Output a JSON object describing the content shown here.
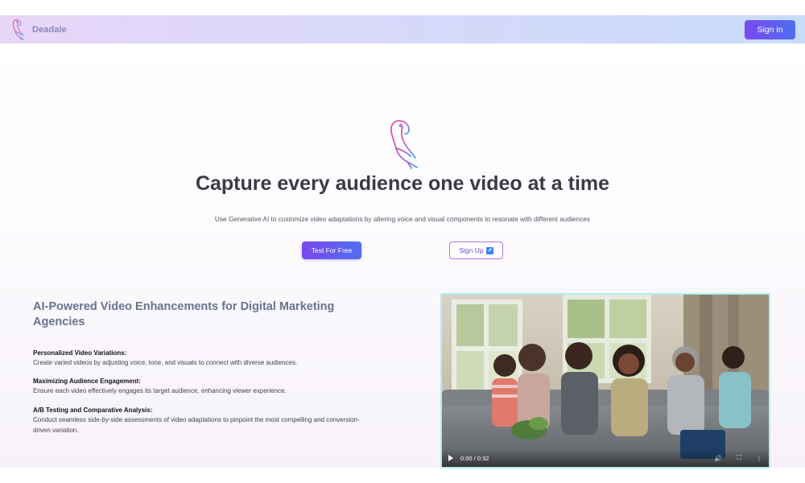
{
  "nav": {
    "brand": "Deadale",
    "signin_label": "Sign in"
  },
  "hero": {
    "title": "Capture every audience one video at a time",
    "subtitle": "Use Generative AI to customize video adaptations by altering voice and visual components to resonate with different audiences",
    "test_button": "Test For Free",
    "signup_button": "Sign Up",
    "signup_icon": "north-east-arrow-icon"
  },
  "features": {
    "heading": "AI-Powered Video Enhancements for Digital Marketing Agencies",
    "items": [
      {
        "title": "Personalized Video Variations:",
        "desc": "Create varied videos by adjusting voice, tone, and visuals to connect with diverse audiences."
      },
      {
        "title": "Maximizing Audience Engagement:",
        "desc": "Ensure each video effectively engages its target audience, enhancing viewer experience."
      },
      {
        "title": "A/B Testing and Comparative Analysis:",
        "desc": "Conduct seamless side-by-side assessments of video adaptations to pinpoint the most compelling and conversion-driven variation."
      }
    ]
  },
  "video": {
    "time": "0:00 / 0:32",
    "icons": [
      "play-icon",
      "volume-icon",
      "fullscreen-icon",
      "more-options-icon"
    ]
  },
  "colors": {
    "accent_start": "#7a48ee",
    "accent_end": "#4e6ef0",
    "video_border": "#aef0ef"
  }
}
